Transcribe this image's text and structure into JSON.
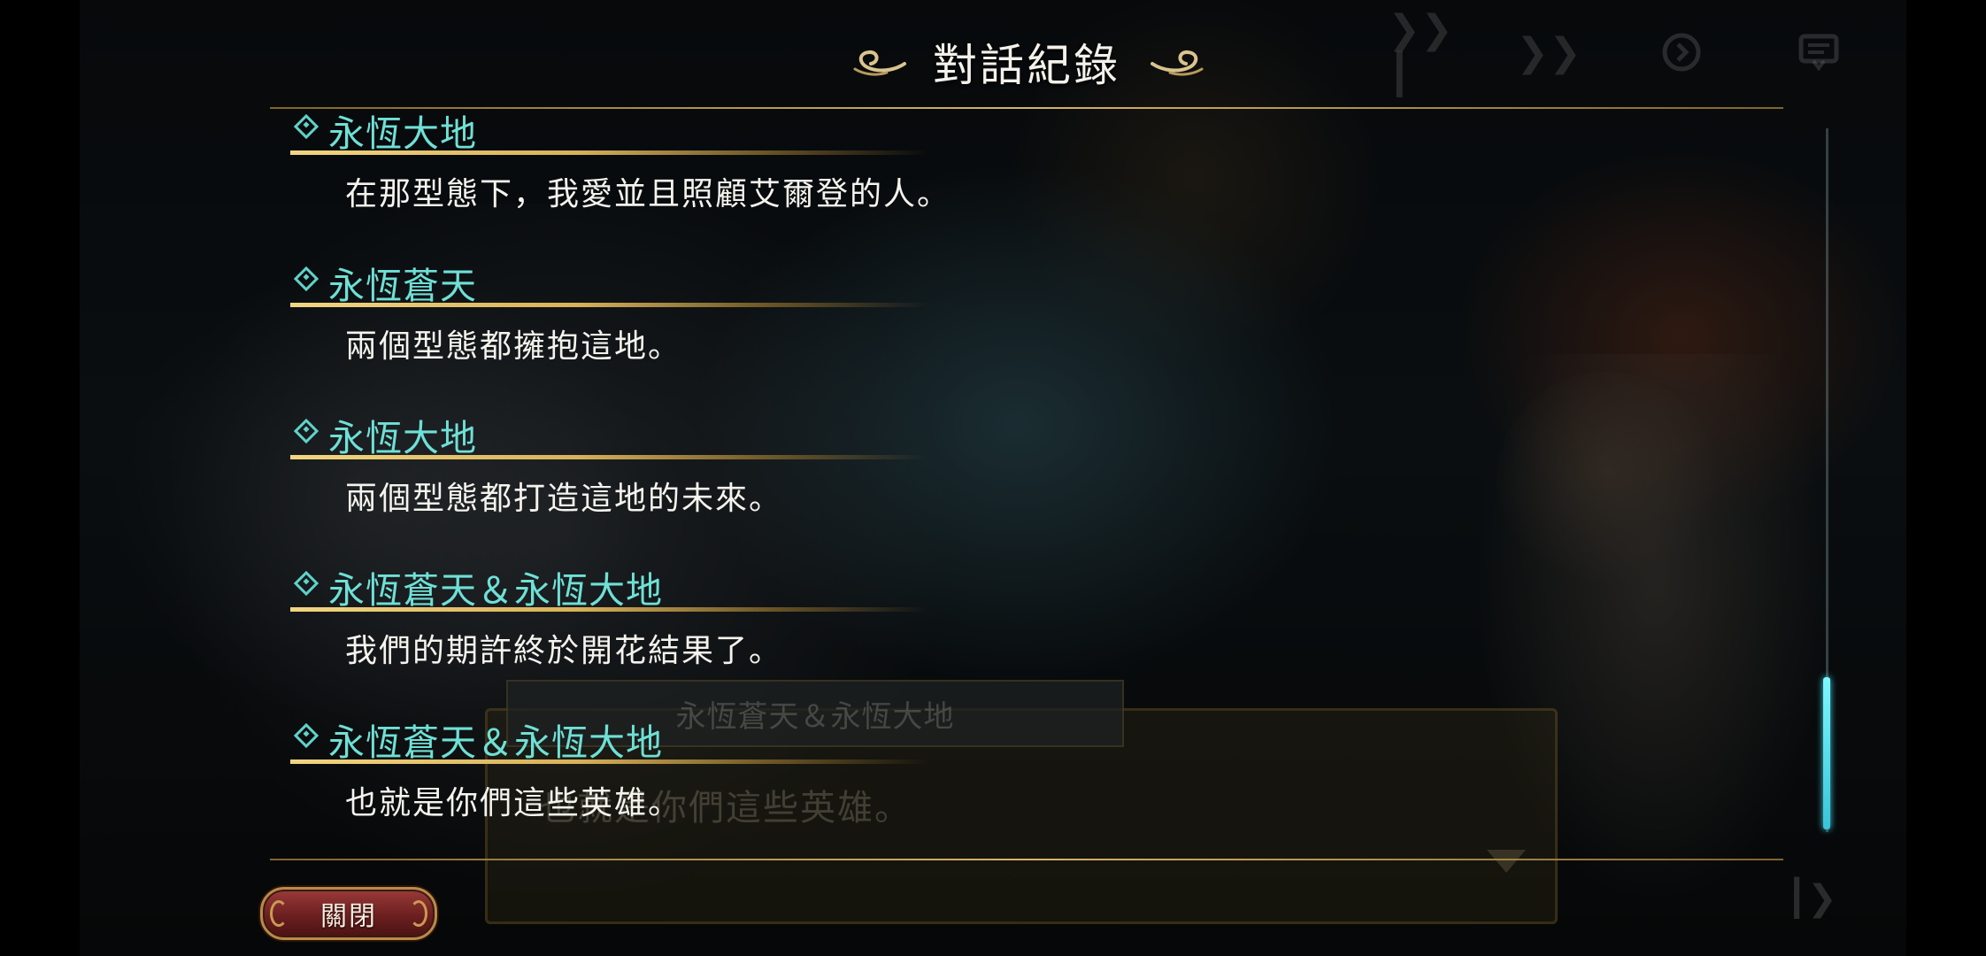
{
  "header": {
    "title": "對話紀錄"
  },
  "top_controls": [
    {
      "name": "skip-icon"
    },
    {
      "name": "fast-forward-icon"
    },
    {
      "name": "auto-play-icon"
    },
    {
      "name": "log-icon"
    }
  ],
  "log": {
    "entries": [
      {
        "speaker": "永恆大地",
        "text": "在那型態下，我愛並且照顧艾爾登的人。"
      },
      {
        "speaker": "永恆蒼天",
        "text": "兩個型態都擁抱這地。"
      },
      {
        "speaker": "永恆大地",
        "text": "兩個型態都打造這地的未來。"
      },
      {
        "speaker": "永恆蒼天＆永恆大地",
        "text": "我們的期許終於開花結果了。"
      },
      {
        "speaker": "永恆蒼天＆永恆大地",
        "text": "也就是你們這些英雄。"
      }
    ]
  },
  "background_dialog": {
    "speaker": "永恆蒼天＆永恆大地",
    "text": "也就是你們這些英雄。"
  },
  "footer": {
    "close_label": "關閉"
  },
  "colors": {
    "speaker": "#6fe0d6",
    "text": "#f5f3ee",
    "gold": "#d6b468",
    "scroll_thumb": "#4fdcef"
  }
}
